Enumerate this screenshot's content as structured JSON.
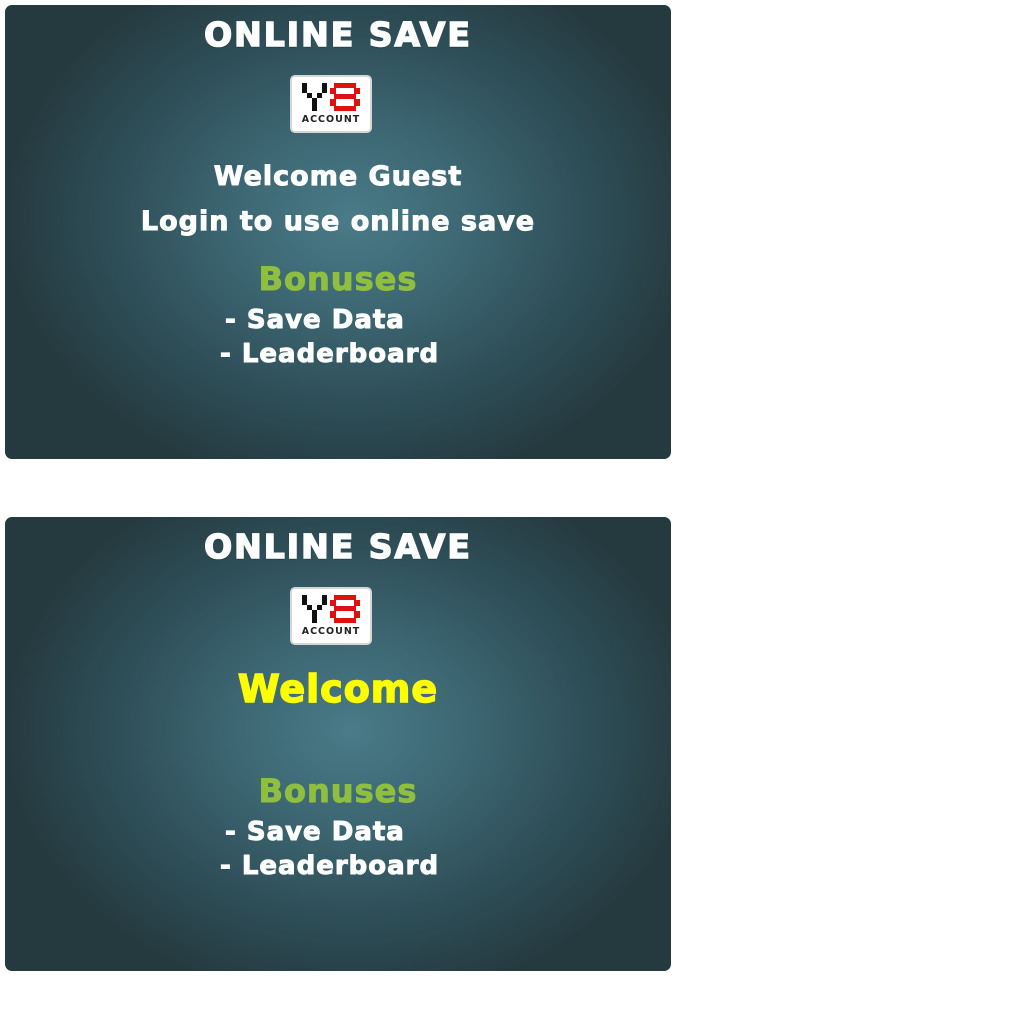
{
  "screen_top": {
    "title": "ONLINE SAVE",
    "logo_word": "ACCOUNT",
    "welcome": "Welcome Guest",
    "login_prompt": "Login to use online save",
    "bonuses_heading": "Bonuses",
    "bonuses": [
      "- Save Data",
      "- Leaderboard"
    ]
  },
  "screen_bottom": {
    "title": "ONLINE SAVE",
    "logo_word": "ACCOUNT",
    "welcome": "Welcome",
    "bonuses_heading": "Bonuses",
    "bonuses": [
      "- Save Data",
      "- Leaderboard"
    ]
  },
  "colors": {
    "panel_center": "#4a7b88",
    "panel_edge": "#253a3f",
    "bonuses_green": "#8fbf3f",
    "welcome_yellow": "#ffff00",
    "logo_red": "#e01010"
  },
  "icons": {
    "logo": "y8-account-logo"
  }
}
